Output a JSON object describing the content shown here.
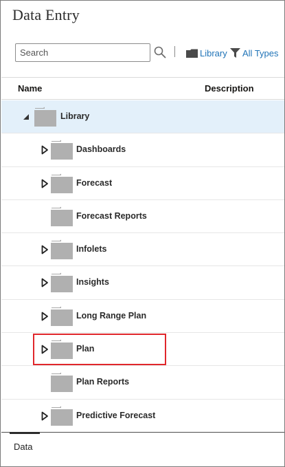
{
  "page": {
    "title": "Data Entry"
  },
  "search": {
    "placeholder": "Search",
    "value": ""
  },
  "filters": {
    "library_label": "Library",
    "types_label": "All Types"
  },
  "columns": {
    "name": "Name",
    "description": "Description"
  },
  "tree": [
    {
      "label": "Library",
      "level": 0,
      "toggle": "expanded",
      "selected": true,
      "description": ""
    },
    {
      "label": "Dashboards",
      "level": 1,
      "toggle": "collapsed",
      "description": ""
    },
    {
      "label": "Forecast",
      "level": 1,
      "toggle": "collapsed",
      "description": ""
    },
    {
      "label": "Forecast Reports",
      "level": 1,
      "toggle": "none",
      "description": ""
    },
    {
      "label": "Infolets",
      "level": 1,
      "toggle": "collapsed",
      "description": ""
    },
    {
      "label": "Insights",
      "level": 1,
      "toggle": "collapsed",
      "description": ""
    },
    {
      "label": "Long Range Plan",
      "level": 1,
      "toggle": "collapsed",
      "description": ""
    },
    {
      "label": "Plan",
      "level": 1,
      "toggle": "collapsed",
      "highlighted": true,
      "description": ""
    },
    {
      "label": "Plan Reports",
      "level": 1,
      "toggle": "none",
      "description": ""
    },
    {
      "label": "Predictive Forecast",
      "level": 1,
      "toggle": "collapsed",
      "description": ""
    }
  ],
  "bottom_tabs": [
    {
      "label": "Data",
      "active": true
    }
  ],
  "colors": {
    "link": "#1f73b7",
    "selected_row": "#e3f0fa",
    "highlight": "#e0262b",
    "folder": "#b0b0b0"
  },
  "icons": {
    "search": "search-icon",
    "folder": "folder-icon",
    "filter": "filter-icon",
    "expand": "triangle-right-icon",
    "collapse": "triangle-down-icon"
  }
}
